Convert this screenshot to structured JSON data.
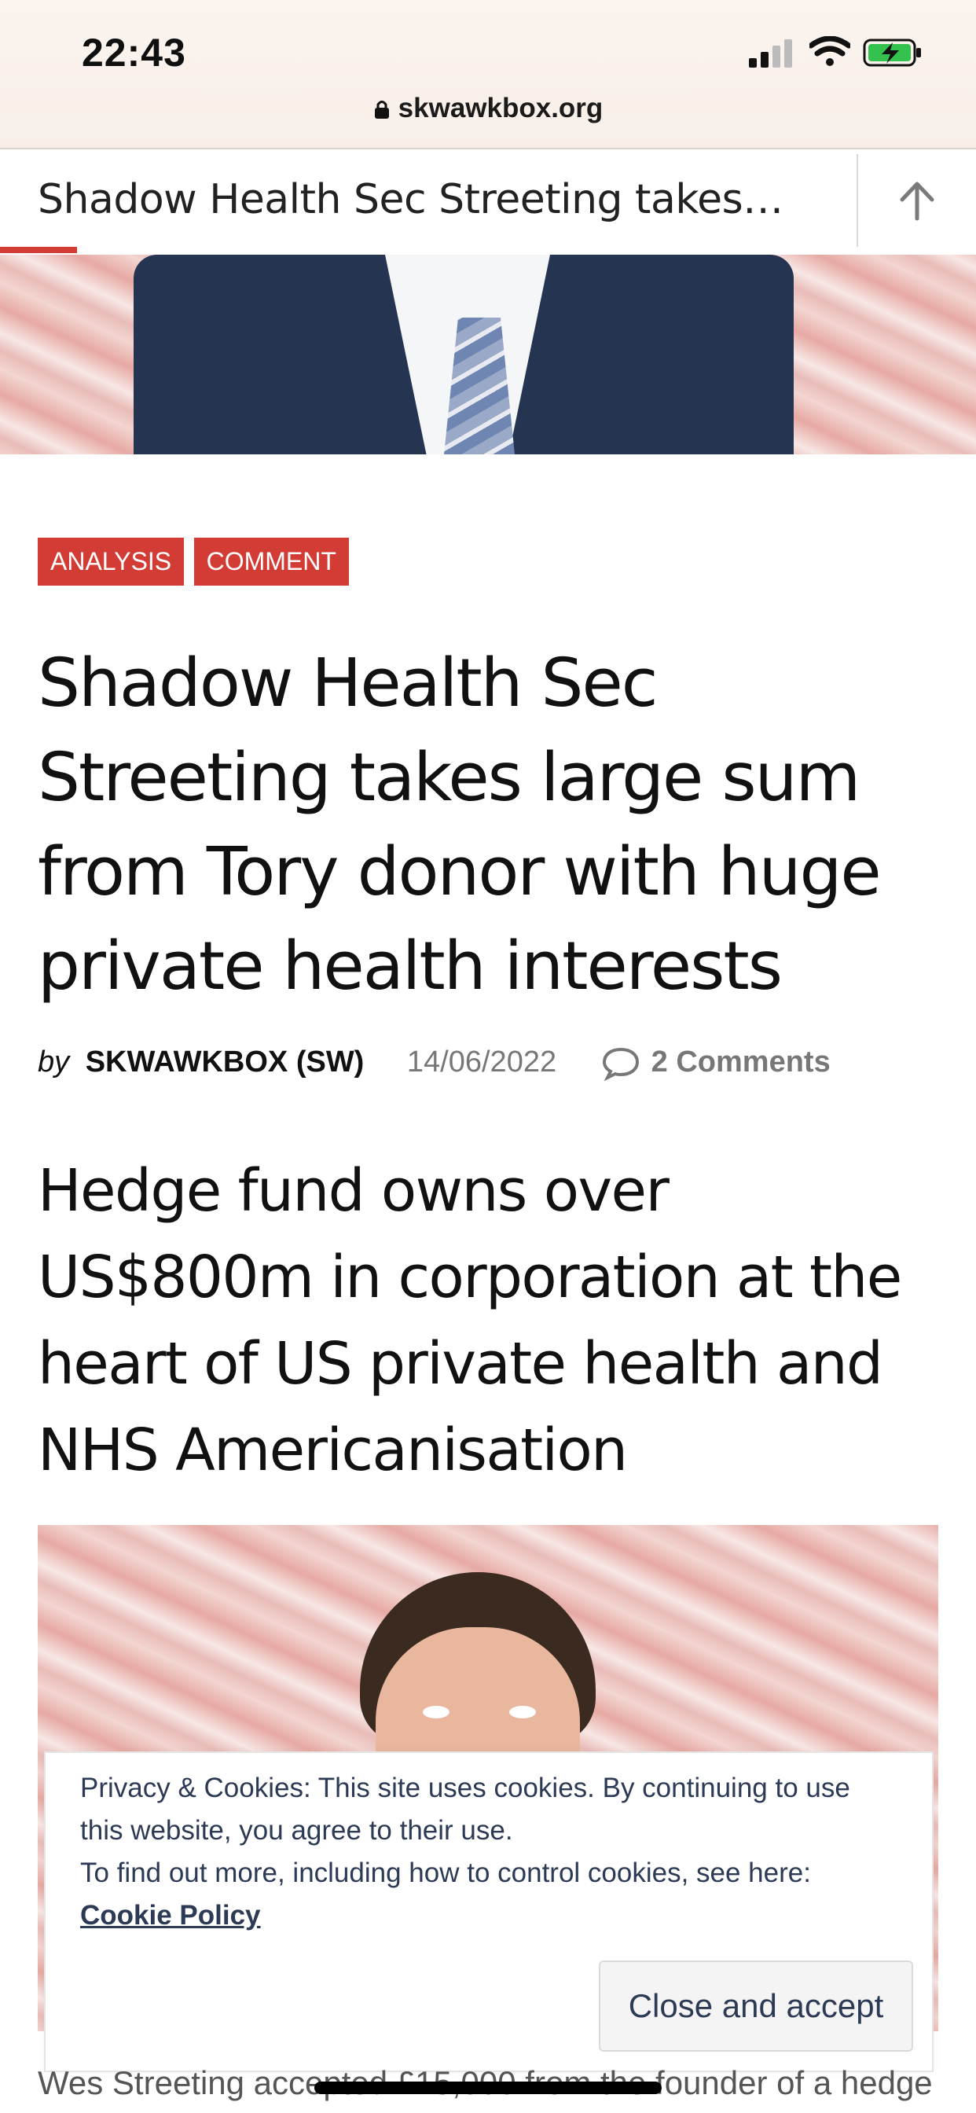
{
  "status_bar": {
    "time": "22:43",
    "url": "skwawkbox.org"
  },
  "sticky_header": {
    "title": "Shadow Health Sec Streeting takes…"
  },
  "article": {
    "categories": [
      "ANALYSIS",
      "COMMENT"
    ],
    "title": "Shadow Health Sec Streeting takes large sum from Tory donor with huge private health interests",
    "byline_prefix": "by",
    "author": "SKWAWKBOX (SW)",
    "date": "14/06/2022",
    "comments": "2 Comments",
    "subtitle": "Hedge fund owns over US$800m in corporation at the heart of US private health and NHS Americanisation",
    "bottom_text": "Wes Streeting accepted £15,000 from the founder of a hedge"
  },
  "cookie_banner": {
    "text_line1": "Privacy & Cookies: This site uses cookies. By continuing to use this website, you agree to their use.",
    "text_line2_prefix": "To find out more, including how to control cookies, see here:",
    "link_label": "Cookie Policy",
    "button_label": "Close and accept"
  },
  "colors": {
    "accent": "#d33c34",
    "cookie_text": "#2d3a55"
  }
}
